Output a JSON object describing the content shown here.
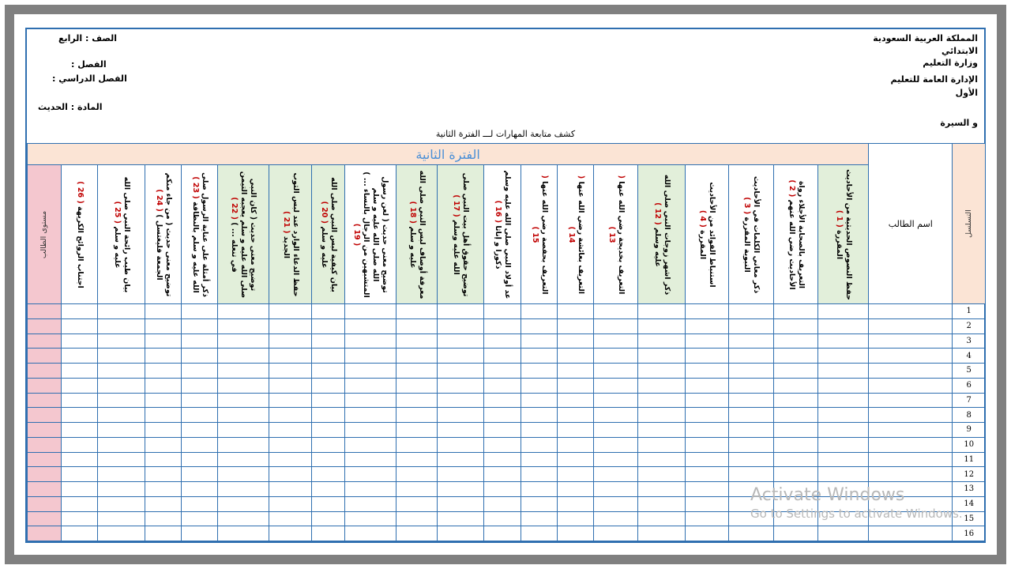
{
  "header_right": {
    "kingdom": "المملكة العربية السعودية",
    "primary": "الابتدائي",
    "ministry": "وزارة التعليم",
    "admin": "الإدارة العامة للتعليم",
    "first": "الأول",
    "and_seerah": "و السيرة"
  },
  "header_left": {
    "grade": "الصف : الرابع",
    "class": "الفصل :",
    "semester": "الفصل الدراسي :",
    "subject": "المادة : الحديث"
  },
  "subtitle": "كشف متابعة المهارات لـــ الفترة الثانية",
  "period_label": "الفترة الثانية",
  "seq_header": "التسلسل",
  "name_header": "اسم الطالب",
  "level_header": "مستوى الطالب",
  "skills": [
    {
      "text": "حفظ النصوص الحديثية من الأحاديث المقررة",
      "num": "( 1 )"
    },
    {
      "text": "التعريف بالصحابة الأجلاء رواة الأحاديث رضي الله عنهم",
      "num": "( 2 )"
    },
    {
      "text": "ذكر معاني الكلمات في الأحاديث النبوية المقررة",
      "num": "( 3 )"
    },
    {
      "text": "استنباط الفوائد من الأحاديث المقررة",
      "num": "( 4 )"
    },
    {
      "text": "ذكر اشهر زوجات النبي صلى الله عليه وسلم",
      "num": "( 12 )"
    },
    {
      "text": "التعريف بخديجة رضي الله عنها",
      "num": "( 13 )"
    },
    {
      "text": "التعريف بعائشة رضي الله عنها",
      "num": "( 14 )"
    },
    {
      "text": "التعريف بحفصة رضي الله عنها",
      "num": "( 15 )"
    },
    {
      "text": "عد أولاد النبي صلى الله عليه وسلم ذكورا و إناثا",
      "num": "( 16 )"
    },
    {
      "text": "توضيح حقوق أهل بيت النبي صلى الله عليه وسلم",
      "num": "( 17 )"
    },
    {
      "text": "معرفة أوصاف لبس النبي صلى الله عليه و سلم",
      "num": "( 18 )"
    },
    {
      "text": "توضيح معنى حديث ( لعن رسول الله صلى الله عليه و سلم المتشبهين من الرجال بالنساء ... )",
      "num": "( 19 )"
    },
    {
      "text": "بيان كيفية لبس النبي صلى الله عليه و سلم",
      "num": "( 20 )"
    },
    {
      "text": "حفظ الدعاء الوارد عند لبس الثوب الجديد",
      "num": "( 21 )"
    },
    {
      "text": "توضيح معنى حديث ( كان النبي صلى الله عليه و سلم يعجبه التيمن في تنعله ... )",
      "num": "( 22 )"
    },
    {
      "text": "ذكر أمثلة على عناية الرسول صلى الله عليه و سلم بالنظافة",
      "num": "( 23 )"
    },
    {
      "text": "توضيح معنى حديث ( من جاء منكم الجمعة فليغتسل )",
      "num": "( 24 )"
    },
    {
      "text": "بيان طيب رائحة النبي صلى الله عليه و سلم",
      "num": "( 25 )"
    },
    {
      "text": "اجتناب الروائح الكريهة",
      "num": "( 26 )"
    }
  ],
  "rows": [
    "1",
    "2",
    "3",
    "4",
    "5",
    "6",
    "7",
    "8",
    "9",
    "10",
    "11",
    "12",
    "13",
    "14",
    "15",
    "16"
  ],
  "watermark": {
    "line1": "Activate Windows",
    "line2": "Go to Settings to activate Windows."
  }
}
